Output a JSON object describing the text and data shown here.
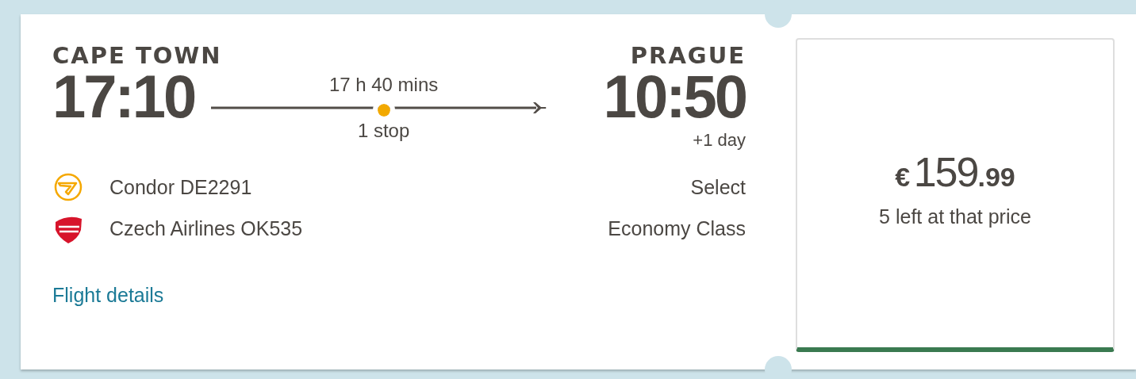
{
  "origin": {
    "city": "CAPE TOWN",
    "time": "17:10"
  },
  "journey": {
    "duration": "17 h 40 mins",
    "stops_label": "1 stop",
    "layovers": [
      {
        "color": "#f2a900"
      }
    ]
  },
  "destination": {
    "city": "PRAGUE",
    "time": "10:50",
    "day_offset": "+1 day"
  },
  "airlines": [
    {
      "kind": "condor",
      "name": "Condor DE2291",
      "extra": "Select"
    },
    {
      "kind": "csa",
      "name": "Czech Airlines OK535",
      "extra": "Economy Class"
    }
  ],
  "details_link": "Flight details",
  "price": {
    "currency": "€",
    "whole": "159",
    "cents": ".99",
    "note": "5 left at that price"
  }
}
